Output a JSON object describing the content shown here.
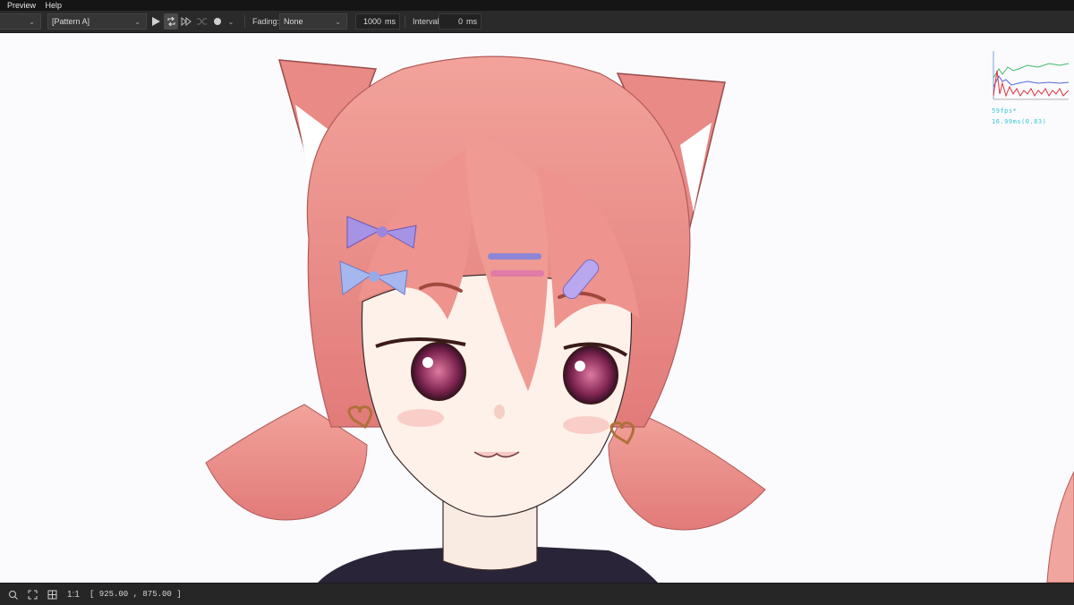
{
  "menubar": {
    "items": [
      "Preview",
      "Help"
    ]
  },
  "toolbar": {
    "pattern_dropdown": {
      "value": "[Pattern A]"
    },
    "fading": {
      "label": "Fading:",
      "value": "None"
    },
    "duration": {
      "value": "1000",
      "unit": "ms"
    },
    "interval": {
      "label": "Interval:",
      "value": "0",
      "unit": "ms"
    }
  },
  "performance_overlay": {
    "fps_text": "59fps*",
    "ms_text": "16.99ms(0.83)"
  },
  "statusbar": {
    "zoom_ratio": "1:1",
    "coords": "[ 925.00 ,  875.00 ]"
  },
  "colors": {
    "menubar_bg": "#151515",
    "toolbar_bg": "#2a2a2a",
    "canvas_bg": "#fbfbfd",
    "hair": "#e98a86",
    "perf_text": "#39c6d6"
  },
  "icons": [
    "play-icon",
    "loop-icon",
    "step-forward-icon",
    "shuffle-icon",
    "record-icon",
    "zoom-icon",
    "fit-icon",
    "frame-icon"
  ]
}
